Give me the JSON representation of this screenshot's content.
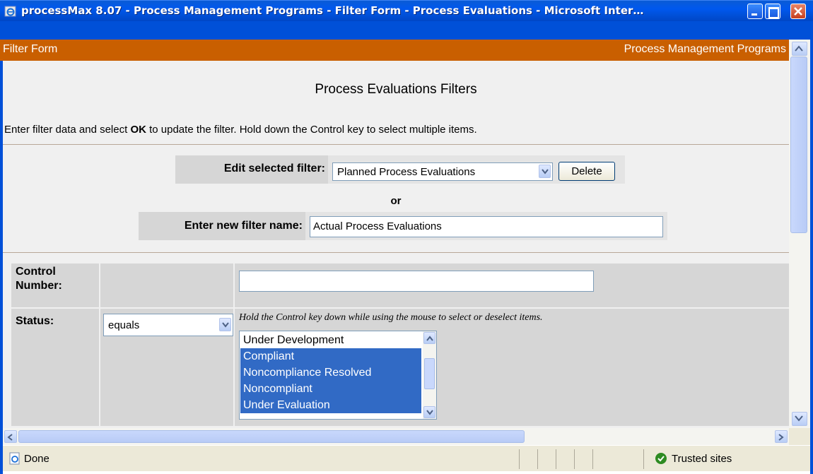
{
  "window": {
    "title": "processMax 8.07 - Process Management Programs - Filter Form - Process Evaluations - Microsoft Inter…"
  },
  "header": {
    "left": "Filter Form",
    "right": "Process Management Programs"
  },
  "form": {
    "title": "Process Evaluations Filters",
    "instructions_pre": "Enter filter data and select ",
    "instructions_bold": "OK",
    "instructions_post": " to update the filter. Hold down the Control key to select multiple items.",
    "edit_label": "Edit selected filter:",
    "edit_selected": "Planned Process Evaluations",
    "delete_label": "Delete",
    "or_label": "or",
    "new_label": "Enter new filter name:",
    "new_value": "Actual Process Evaluations"
  },
  "rows": {
    "control_number_label": "Control Number:",
    "control_number_value": "",
    "status_label": "Status:",
    "status_operator": "equals",
    "status_hint": "Hold the Control key down while using the mouse to select or deselect items.",
    "status_options": [
      {
        "label": "Under Development",
        "selected": false
      },
      {
        "label": "Compliant",
        "selected": true
      },
      {
        "label": "Noncompliance Resolved",
        "selected": true
      },
      {
        "label": "Noncompliant",
        "selected": true
      },
      {
        "label": "Under Evaluation",
        "selected": true
      }
    ]
  },
  "statusbar": {
    "left": "Done",
    "zone": "Trusted sites"
  },
  "colors": {
    "header": "#c95f00",
    "titlebar": "#0050d8",
    "selection": "#316ac5"
  }
}
